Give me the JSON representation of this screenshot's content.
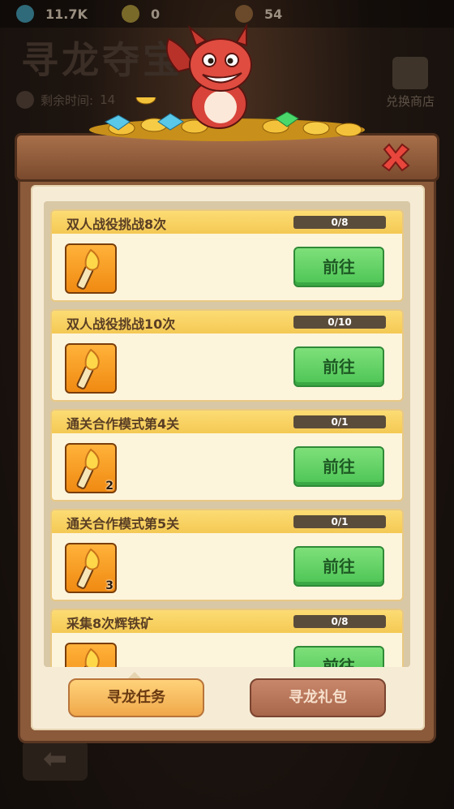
{
  "top_bar": {
    "gems": "11.7K",
    "coins": "0",
    "torches": "54"
  },
  "background": {
    "title": "寻龙夺宝",
    "timer_label": "剩余时间:",
    "timer_value": "14",
    "shop_label": "兑换商店"
  },
  "tasks": [
    {
      "name": "双人战役挑战8次",
      "progress": "0/8",
      "reward_count": "",
      "button": "前往"
    },
    {
      "name": "双人战役挑战10次",
      "progress": "0/10",
      "reward_count": "",
      "button": "前往"
    },
    {
      "name": "通关合作模式第4关",
      "progress": "0/1",
      "reward_count": "2",
      "button": "前往"
    },
    {
      "name": "通关合作模式第5关",
      "progress": "0/1",
      "reward_count": "3",
      "button": "前往"
    },
    {
      "name": "采集8次辉铁矿",
      "progress": "0/8",
      "reward_count": "",
      "button": "前往"
    }
  ],
  "tabs": {
    "tasks_label": "寻龙任务",
    "gift_label": "寻龙礼包"
  },
  "colors": {
    "go_button": "#5cc85e",
    "header_bar": "#f8d466",
    "panel_wood": "#8a5a3a"
  }
}
